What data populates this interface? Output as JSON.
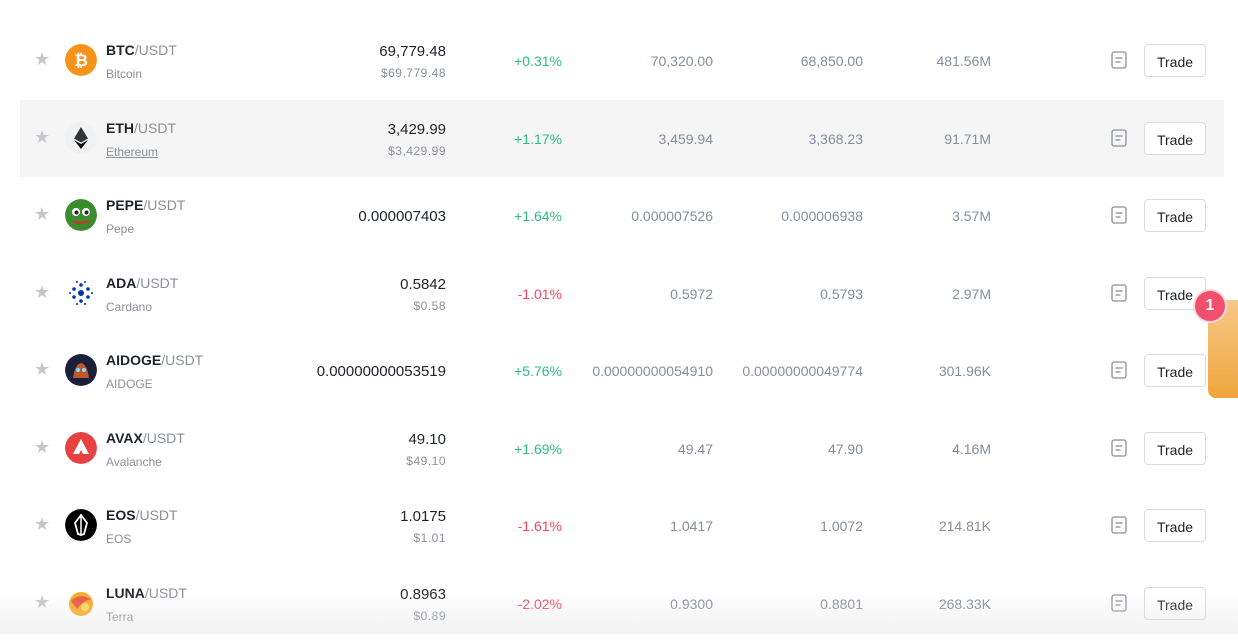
{
  "markets": [
    {
      "base": "BTC",
      "quote": "/USDT",
      "name": "Bitcoin",
      "price": "69,779.48",
      "usd": "$69,779.48",
      "change": "+0.31%",
      "dir": "up",
      "high": "70,320.00",
      "low": "68,850.00",
      "volume": "481.56M",
      "trade": "Trade",
      "icon": "bitcoin-icon",
      "color": "#f7931a"
    },
    {
      "base": "ETH",
      "quote": "/USDT",
      "name": "Ethereum",
      "price": "3,429.99",
      "usd": "$3,429.99",
      "change": "+1.17%",
      "dir": "up",
      "high": "3,459.94",
      "low": "3,368.23",
      "volume": "91.71M",
      "trade": "Trade",
      "icon": "ethereum-icon",
      "color": "#3c3c3d"
    },
    {
      "base": "PEPE",
      "quote": "/USDT",
      "name": "Pepe",
      "price": "0.000007403",
      "usd": "",
      "change": "+1.64%",
      "dir": "up",
      "high": "0.000007526",
      "low": "0.000006938",
      "volume": "3.57M",
      "trade": "Trade",
      "icon": "pepe-icon",
      "color": "#3a8c2f"
    },
    {
      "base": "ADA",
      "quote": "/USDT",
      "name": "Cardano",
      "price": "0.5842",
      "usd": "$0.58",
      "change": "-1.01%",
      "dir": "down",
      "high": "0.5972",
      "low": "0.5793",
      "volume": "2.97M",
      "trade": "Trade",
      "icon": "cardano-icon",
      "color": "#0033ad"
    },
    {
      "base": "AIDOGE",
      "quote": "/USDT",
      "name": "AIDOGE",
      "price": "0.00000000053519",
      "usd": "",
      "change": "+5.76%",
      "dir": "up",
      "high": "0.00000000054910",
      "low": "0.00000000049774",
      "volume": "301.96K",
      "trade": "Trade",
      "icon": "aidoge-icon",
      "color": "#1a1f3a"
    },
    {
      "base": "AVAX",
      "quote": "/USDT",
      "name": "Avalanche",
      "price": "49.10",
      "usd": "$49.10",
      "change": "+1.69%",
      "dir": "up",
      "high": "49.47",
      "low": "47.90",
      "volume": "4.16M",
      "trade": "Trade",
      "icon": "avalanche-icon",
      "color": "#e84142"
    },
    {
      "base": "EOS",
      "quote": "/USDT",
      "name": "EOS",
      "price": "1.0175",
      "usd": "$1.01",
      "change": "-1.61%",
      "dir": "down",
      "high": "1.0417",
      "low": "1.0072",
      "volume": "214.81K",
      "trade": "Trade",
      "icon": "eos-icon",
      "color": "#000000"
    },
    {
      "base": "LUNA",
      "quote": "/USDT",
      "name": "Terra",
      "price": "0.8963",
      "usd": "$0.89",
      "change": "-2.02%",
      "dir": "down",
      "high": "0.9300",
      "low": "0.8801",
      "volume": "268.33K",
      "trade": "Trade",
      "icon": "terra-icon",
      "color": "#f9a825"
    }
  ],
  "notification_badge": "1",
  "colors": {
    "up": "#2ebd85",
    "down": "#f6465d",
    "muted": "#848e9c",
    "highlight_row": "#f5f5f5"
  }
}
